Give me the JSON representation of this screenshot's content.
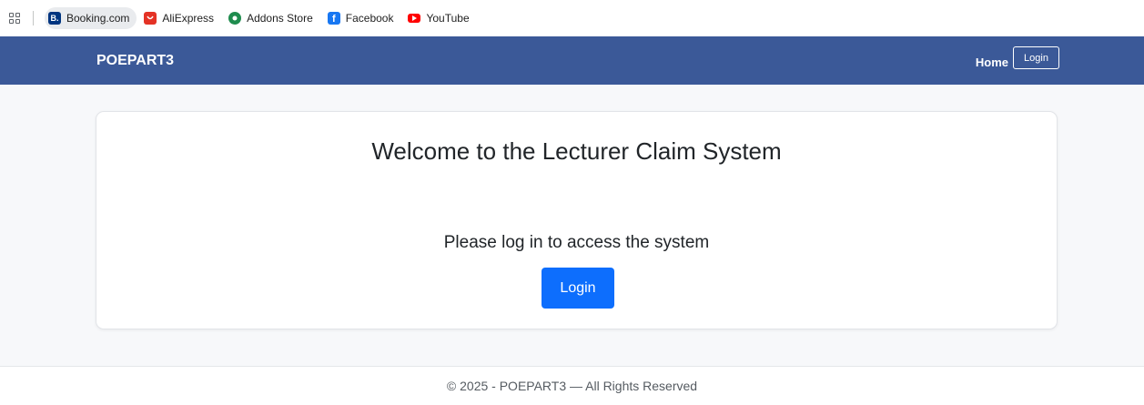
{
  "bookmarks": {
    "items": [
      {
        "label": "Booking.com",
        "icon": "booking-icon",
        "icon_letter": "B.",
        "color": "#003580"
      },
      {
        "label": "AliExpress",
        "icon": "aliexpress-icon",
        "color": "#e43225"
      },
      {
        "label": "Addons Store",
        "icon": "addons-store-icon",
        "color": "#1f8c4e"
      },
      {
        "label": "Facebook",
        "icon": "facebook-icon",
        "icon_letter": "f",
        "color": "#1877f2"
      },
      {
        "label": "YouTube",
        "icon": "youtube-icon",
        "color": "#ff0000"
      }
    ]
  },
  "navbar": {
    "brand": "POEPART3",
    "home_label": "Home",
    "login_label": "Login",
    "background": "#3b5998"
  },
  "main": {
    "title": "Welcome to the Lecturer Claim System",
    "message": "Please log in to access the system",
    "login_button": "Login",
    "button_color": "#0d6efd"
  },
  "footer": {
    "text": "© 2025 - POEPART3 — All Rights Reserved"
  }
}
